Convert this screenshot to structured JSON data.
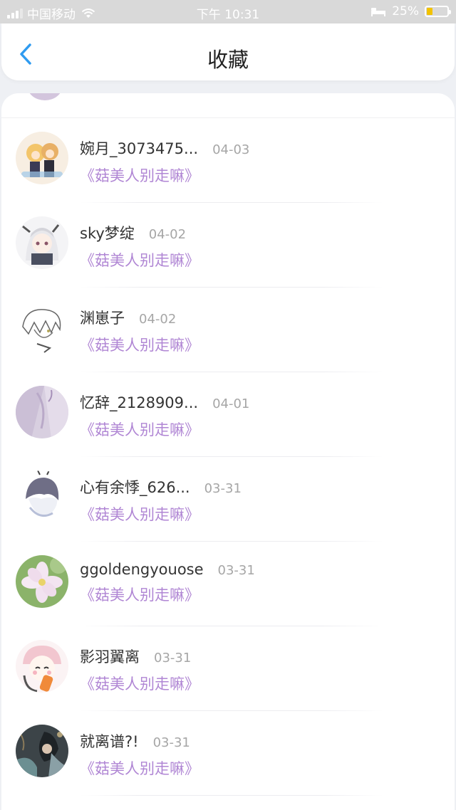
{
  "status_bar": {
    "carrier": "中国移动",
    "time": "下午 10:31",
    "battery_percent": "25%",
    "battery_level": 0.25,
    "icons": [
      "signal-icon",
      "wifi-icon",
      "bed-icon",
      "battery-icon"
    ]
  },
  "header": {
    "title": "收藏",
    "back_icon": "chevron-left-icon",
    "accent_color": "#2f9bf0"
  },
  "colors": {
    "title_purple": "#b086d4",
    "date_gray": "#a6a6a6",
    "background": "#eef0f4"
  },
  "list": {
    "items": [
      {
        "name": "婉月_3073475...",
        "date": "04-03",
        "book": "《菇美人别走嘛》"
      },
      {
        "name": "sky梦绽",
        "date": "04-02",
        "book": "《菇美人别走嘛》"
      },
      {
        "name": "渊崽子",
        "date": "04-02",
        "book": "《菇美人别走嘛》"
      },
      {
        "name": "忆辞_2128909...",
        "date": "04-01",
        "book": "《菇美人别走嘛》"
      },
      {
        "name": "心有余悸_626...",
        "date": "03-31",
        "book": "《菇美人别走嘛》"
      },
      {
        "name": "ggoldengyouose",
        "date": "03-31",
        "book": "《菇美人别走嘛》"
      },
      {
        "name": "影羽翼离",
        "date": "03-31",
        "book": "《菇美人别走嘛》"
      },
      {
        "name": "就离谱?!",
        "date": "03-31",
        "book": "《菇美人别走嘛》"
      }
    ]
  }
}
